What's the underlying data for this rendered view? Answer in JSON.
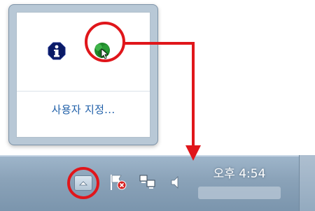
{
  "popup": {
    "customize_label": "사용자 지정...",
    "icons": [
      "info-icon",
      "network-icon"
    ]
  },
  "taskbar": {
    "clock_time": "오후 4:54",
    "tray_icons": [
      "show-hidden-icons-button",
      "action-center-flag-icon",
      "network-icon",
      "volume-icon"
    ]
  },
  "colors": {
    "annotation_red": "#e0161b",
    "link_blue": "#1f5fa8",
    "taskbar": "#8aa2b8"
  }
}
